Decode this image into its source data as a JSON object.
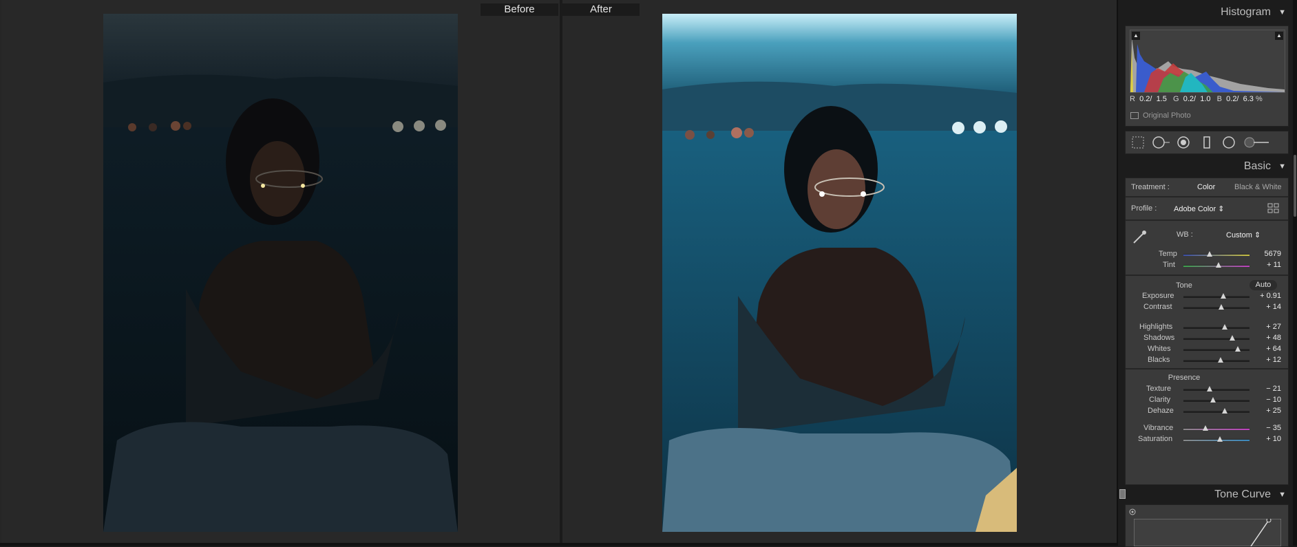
{
  "compare": {
    "before_label": "Before",
    "after_label": "After",
    "before_image": "night portrait photo (dark)",
    "after_image": "night portrait photo (edited, brighter blue)"
  },
  "histogram": {
    "title": "Histogram",
    "r_label": "R",
    "r_value": "0.2/",
    "r_value2": "1.5",
    "g_label": "G",
    "g_value": "0.2/",
    "g_value2": "1.0",
    "b_label": "B",
    "b_value": "0.2/",
    "b_value2": "6.3",
    "percent": "%",
    "original_photo": "Original Photo"
  },
  "tools": [
    "crop-overlay-icon",
    "spot-removal-icon",
    "red-eye-icon",
    "graduated-filter-icon",
    "radial-filter-icon",
    "adjustment-brush-icon"
  ],
  "basic": {
    "title": "Basic",
    "treatment_label": "Treatment :",
    "treatment_color": "Color",
    "treatment_bw": "Black & White",
    "profile_label": "Profile :",
    "profile_value": "Adobe Color",
    "wb_label": "WB :",
    "wb_value": "Custom",
    "temp": {
      "label": "Temp",
      "value": "5679",
      "level": 0.4
    },
    "tint": {
      "label": "Tint",
      "value": "+ 11",
      "level": 0.53
    },
    "tone_label": "Tone",
    "auto_label": "Auto",
    "exposure": {
      "label": "Exposure",
      "value": "+ 0.91",
      "level": 0.6
    },
    "contrast": {
      "label": "Contrast",
      "value": "+ 14",
      "level": 0.57
    },
    "highlights": {
      "label": "Highlights",
      "value": "+ 27",
      "level": 0.63
    },
    "shadows": {
      "label": "Shadows",
      "value": "+ 48",
      "level": 0.74
    },
    "whites": {
      "label": "Whites",
      "value": "+ 64",
      "level": 0.82
    },
    "blacks": {
      "label": "Blacks",
      "value": "+ 12",
      "level": 0.56
    },
    "presence_label": "Presence",
    "texture": {
      "label": "Texture",
      "value": "− 21",
      "level": 0.4
    },
    "clarity": {
      "label": "Clarity",
      "value": "− 10",
      "level": 0.45
    },
    "dehaze": {
      "label": "Dehaze",
      "value": "+ 25",
      "level": 0.63
    },
    "vibrance": {
      "label": "Vibrance",
      "value": "− 35",
      "level": 0.33
    },
    "saturation": {
      "label": "Saturation",
      "value": "+ 10",
      "level": 0.55
    }
  },
  "tone_curve": {
    "title": "Tone Curve"
  },
  "colors": {
    "panel_bg": "#3a3a3a",
    "app_bg": "#262626"
  }
}
